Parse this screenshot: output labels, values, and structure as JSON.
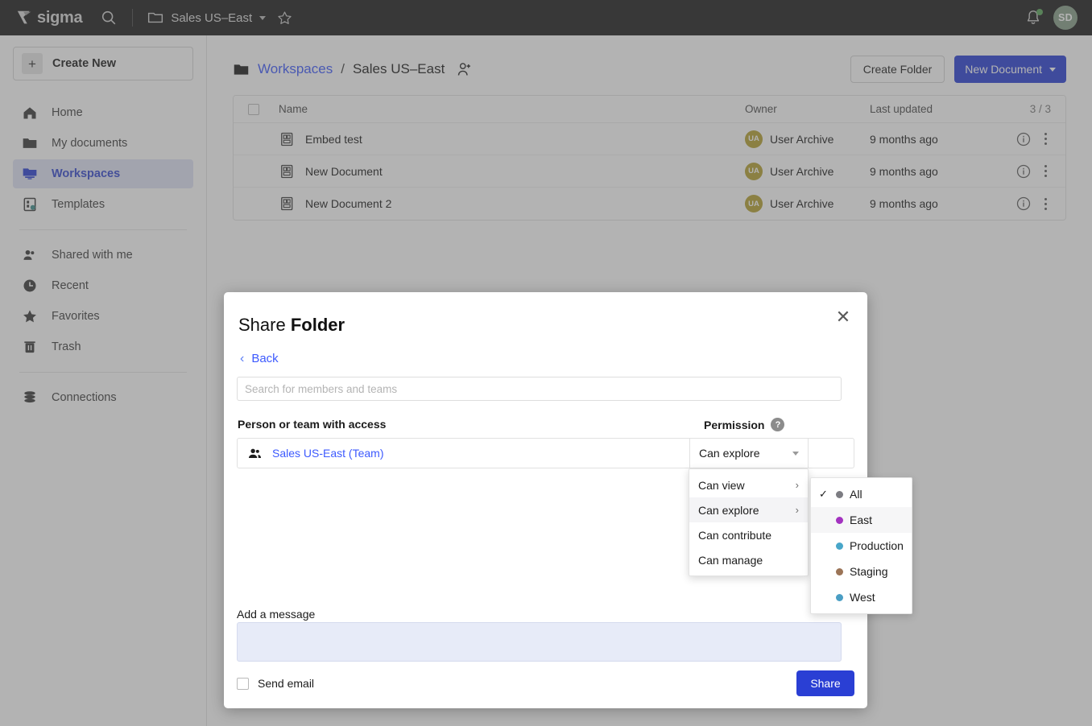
{
  "topbar": {
    "logo_text": "sigma",
    "search_icon": "search-icon",
    "folder_icon": "folder-icon",
    "breadcrumb": "Sales US–East",
    "caret_icon": "chevron-down-icon",
    "star_icon": "star-icon",
    "bell_icon": "bell-icon",
    "avatar_initials": "SD",
    "avatar_color": "#87a08a"
  },
  "sidebar": {
    "create_new": {
      "label": "Create New",
      "icon": "plus-icon"
    },
    "items": [
      {
        "label": "Home",
        "icon": "home-icon",
        "active": false
      },
      {
        "label": "My documents",
        "icon": "folder-icon",
        "active": false
      },
      {
        "label": "Workspaces",
        "icon": "workspaces-icon",
        "active": true
      },
      {
        "label": "Templates",
        "icon": "templates-icon",
        "active": false
      }
    ],
    "items2": [
      {
        "label": "Shared with me",
        "icon": "people-icon"
      },
      {
        "label": "Recent",
        "icon": "clock-icon"
      },
      {
        "label": "Favorites",
        "icon": "star-icon"
      },
      {
        "label": "Trash",
        "icon": "trash-icon"
      }
    ],
    "items3": [
      {
        "label": "Connections",
        "icon": "database-icon"
      }
    ]
  },
  "main": {
    "breadcrumb": {
      "folder_icon": "folder-icon",
      "root": "Workspaces",
      "separator": "/",
      "current": "Sales US–East",
      "add_user_icon": "add-user-icon"
    },
    "buttons": {
      "create_folder": "Create Folder",
      "new_document": "New Document"
    },
    "table": {
      "headers": {
        "name": "Name",
        "owner": "Owner",
        "last_updated": "Last updated",
        "count": "3 / 3"
      },
      "rows": [
        {
          "name": "Embed test",
          "owner_initials": "UA",
          "owner": "User Archive",
          "updated": "9 months ago"
        },
        {
          "name": "New Document",
          "owner_initials": "UA",
          "owner": "User Archive",
          "updated": "9 months ago"
        },
        {
          "name": "New Document 2",
          "owner_initials": "UA",
          "owner": "User Archive",
          "updated": "9 months ago"
        }
      ]
    }
  },
  "modal": {
    "title_prefix": "Share ",
    "title_bold": "Folder",
    "close_icon": "close-icon",
    "back_label": "Back",
    "search_placeholder": "Search for members and teams",
    "search_value": "",
    "access_header": "Person or team with access",
    "permission_header": "Permission",
    "help_icon": "question-icon",
    "team_row": {
      "icon": "team-icon",
      "name": "Sales US-East (Team)"
    },
    "permission_selected": "Can explore",
    "permission_options": [
      {
        "label": "Can view",
        "has_submenu": true,
        "highlighted": false
      },
      {
        "label": "Can explore",
        "has_submenu": true,
        "highlighted": true
      },
      {
        "label": "Can contribute",
        "has_submenu": false,
        "highlighted": false
      },
      {
        "label": "Can manage",
        "has_submenu": false,
        "highlighted": false
      }
    ],
    "scope_options": [
      {
        "label": "All",
        "color": "#7c7c82",
        "checked": true,
        "highlighted": false
      },
      {
        "label": "East",
        "color": "#a332c0",
        "checked": false,
        "highlighted": true
      },
      {
        "label": "Production",
        "color": "#48a6c9",
        "checked": false,
        "highlighted": false
      },
      {
        "label": "Staging",
        "color": "#9b7457",
        "checked": false,
        "highlighted": false
      },
      {
        "label": "West",
        "color": "#4a9ec4",
        "checked": false,
        "highlighted": false
      }
    ],
    "message_label": "Add a message",
    "message_value": "",
    "send_email_label": "Send email",
    "send_email_checked": false,
    "share_button": "Share"
  }
}
